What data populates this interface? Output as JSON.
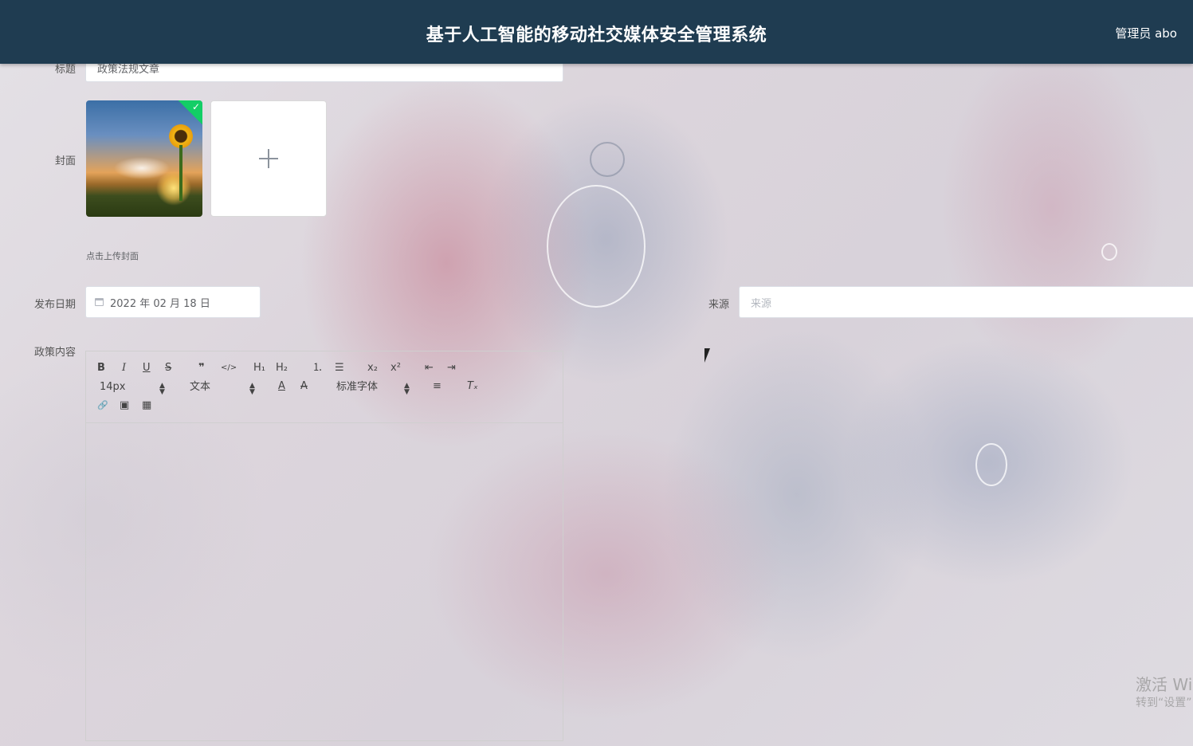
{
  "header": {
    "title": "基于人工智能的移动社交媒体安全管理系统",
    "user": "管理员 abo"
  },
  "form": {
    "title_label": "标题",
    "title_value": "政策法规文章",
    "cover_label": "封面",
    "cover_hint": "点击上传封面",
    "date_label": "发布日期",
    "date_value": "2022 年 02 月 18 日",
    "source_label": "来源",
    "source_placeholder": "来源",
    "content_label": "政策内容"
  },
  "editor": {
    "toolbar": {
      "bold": "B",
      "italic": "I",
      "underline": "U",
      "strike": "S",
      "quote": "❞",
      "code": "</>",
      "h1": "H₁",
      "h2": "H₂",
      "ordered_list": "⒈",
      "bullet_list": "☰",
      "subscript": "x₂",
      "superscript": "x²",
      "outdent": "⇤",
      "indent": "⇥",
      "size_select": "14px",
      "header_select": "文本",
      "font_color": "A",
      "background_color": "A",
      "font_select": "标准字体",
      "align": "≡",
      "clean": "Tₓ",
      "link": "🔗",
      "image": "▣",
      "video": "▦"
    }
  },
  "watermark": {
    "line1": "激活 Wi",
    "line2": "转到“设置”"
  },
  "colors": {
    "header_bg": "#1f3c51",
    "success_badge": "#13ce66"
  }
}
